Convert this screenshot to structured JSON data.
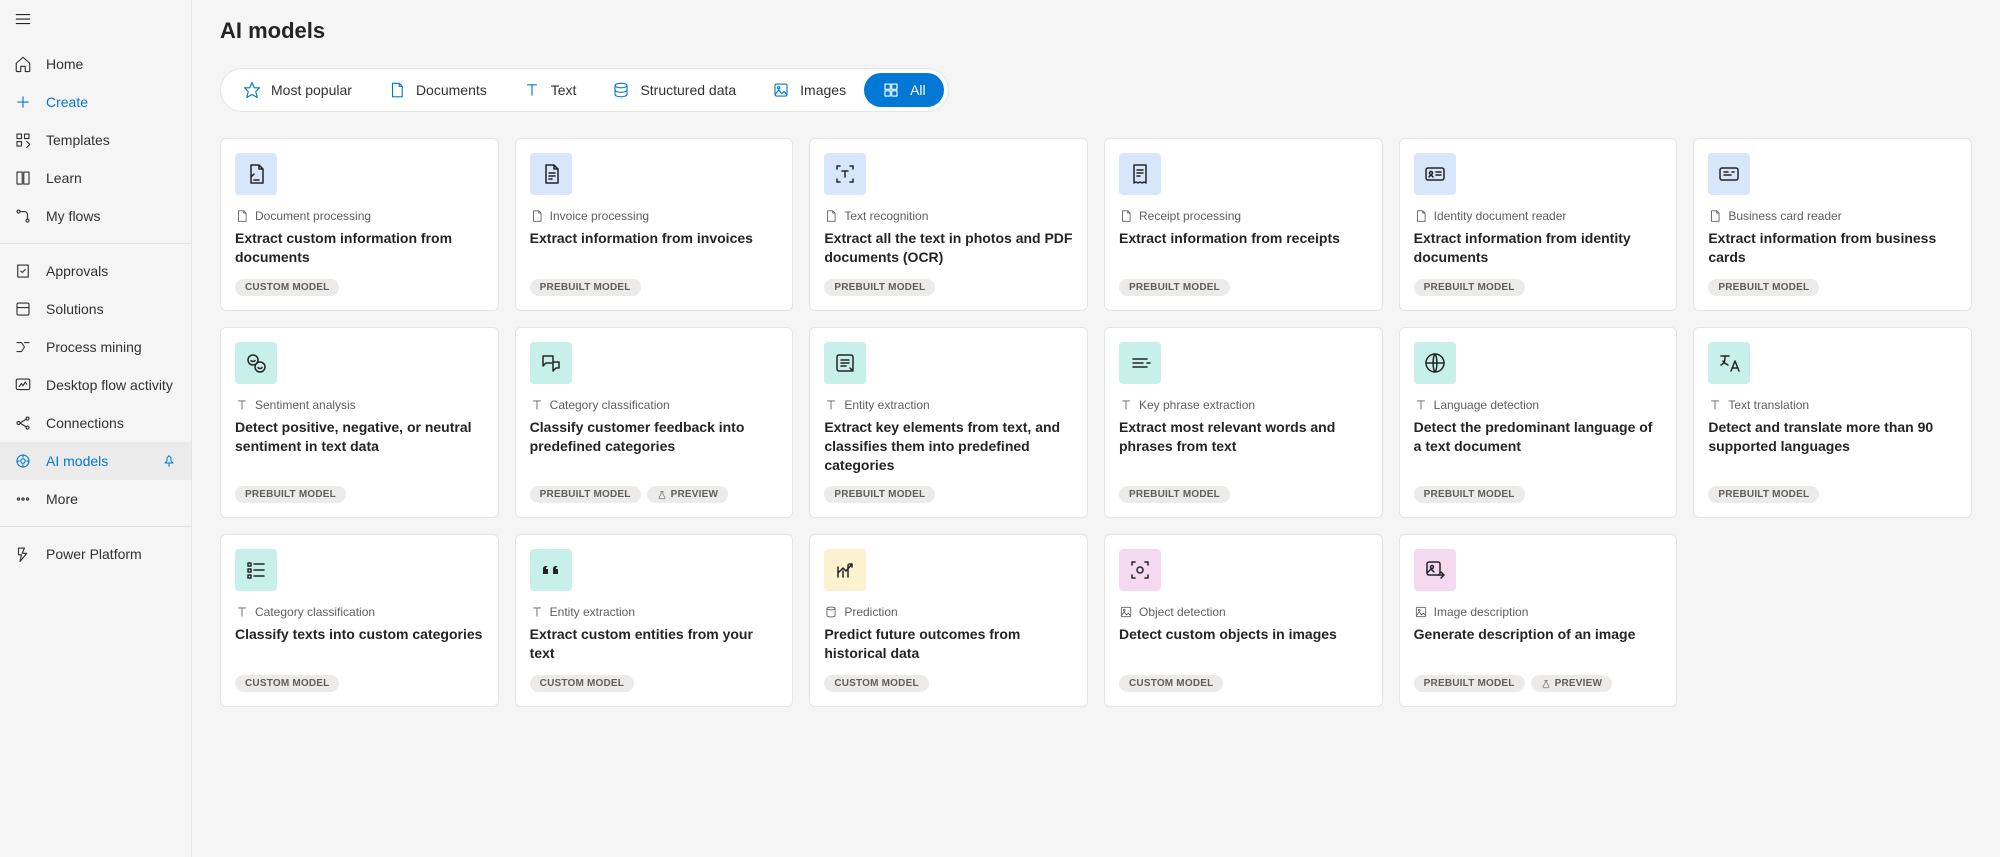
{
  "sidebar": {
    "items": [
      {
        "label": "Home"
      },
      {
        "label": "Create"
      },
      {
        "label": "Templates"
      },
      {
        "label": "Learn"
      },
      {
        "label": "My flows"
      },
      {
        "label": "Approvals"
      },
      {
        "label": "Solutions"
      },
      {
        "label": "Process mining"
      },
      {
        "label": "Desktop flow activity"
      },
      {
        "label": "Connections"
      },
      {
        "label": "AI models"
      },
      {
        "label": "More"
      },
      {
        "label": "Power Platform"
      }
    ]
  },
  "page": {
    "title": "AI models"
  },
  "filters": {
    "most_popular": "Most popular",
    "documents": "Documents",
    "text": "Text",
    "structured": "Structured data",
    "images": "Images",
    "all": "All"
  },
  "badges": {
    "custom": "CUSTOM MODEL",
    "prebuilt": "PREBUILT MODEL",
    "preview": "PREVIEW"
  },
  "cards": [
    {
      "cat": "Document processing",
      "cat_type": "doc",
      "title": "Extract custom information from documents",
      "badge": "custom",
      "icon": "doc-extract",
      "tint": "blue"
    },
    {
      "cat": "Invoice processing",
      "cat_type": "doc",
      "title": "Extract information from invoices",
      "badge": "prebuilt",
      "icon": "invoice",
      "tint": "blue"
    },
    {
      "cat": "Text recognition",
      "cat_type": "doc",
      "title": "Extract all the text in photos and PDF documents (OCR)",
      "badge": "prebuilt",
      "icon": "ocr",
      "tint": "blue"
    },
    {
      "cat": "Receipt processing",
      "cat_type": "doc",
      "title": "Extract information from receipts",
      "badge": "prebuilt",
      "icon": "receipt",
      "tint": "blue"
    },
    {
      "cat": "Identity document reader",
      "cat_type": "doc",
      "title": "Extract information from identity documents",
      "badge": "prebuilt",
      "icon": "identity",
      "tint": "blue"
    },
    {
      "cat": "Business card reader",
      "cat_type": "doc",
      "title": "Extract information from business cards",
      "badge": "prebuilt",
      "icon": "bizcard",
      "tint": "blue"
    },
    {
      "cat": "Sentiment analysis",
      "cat_type": "text",
      "title": "Detect positive, negative, or neutral sentiment in text data",
      "badge": "prebuilt",
      "icon": "sentiment",
      "tint": "teal"
    },
    {
      "cat": "Category classification",
      "cat_type": "text",
      "title": "Classify customer feedback into predefined categories",
      "badge": "prebuilt",
      "preview": true,
      "icon": "feedback",
      "tint": "teal"
    },
    {
      "cat": "Entity extraction",
      "cat_type": "text",
      "title": "Extract key elements from text, and classifies them into predefined categories",
      "badge": "prebuilt",
      "icon": "entity",
      "tint": "teal"
    },
    {
      "cat": "Key phrase extraction",
      "cat_type": "text",
      "title": "Extract most relevant words and phrases from text",
      "badge": "prebuilt",
      "icon": "keyphrase",
      "tint": "teal"
    },
    {
      "cat": "Language detection",
      "cat_type": "text",
      "title": "Detect the predominant language of a text document",
      "badge": "prebuilt",
      "icon": "language",
      "tint": "teal"
    },
    {
      "cat": "Text translation",
      "cat_type": "text",
      "title": "Detect and translate more than 90 supported languages",
      "badge": "prebuilt",
      "icon": "translate",
      "tint": "teal"
    },
    {
      "cat": "Category classification",
      "cat_type": "text",
      "title": "Classify texts into custom categories",
      "badge": "custom",
      "icon": "classify",
      "tint": "teal"
    },
    {
      "cat": "Entity extraction",
      "cat_type": "text",
      "title": "Extract custom entities from your text",
      "badge": "custom",
      "icon": "quote",
      "tint": "teal"
    },
    {
      "cat": "Prediction",
      "cat_type": "data",
      "title": "Predict future outcomes from historical data",
      "badge": "custom",
      "icon": "predict",
      "tint": "yellow"
    },
    {
      "cat": "Object detection",
      "cat_type": "image",
      "title": "Detect custom objects in images",
      "badge": "custom",
      "icon": "object",
      "tint": "pink"
    },
    {
      "cat": "Image description",
      "cat_type": "image",
      "title": "Generate description of an image",
      "badge": "prebuilt",
      "preview": true,
      "icon": "imgdesc",
      "tint": "pink"
    }
  ]
}
